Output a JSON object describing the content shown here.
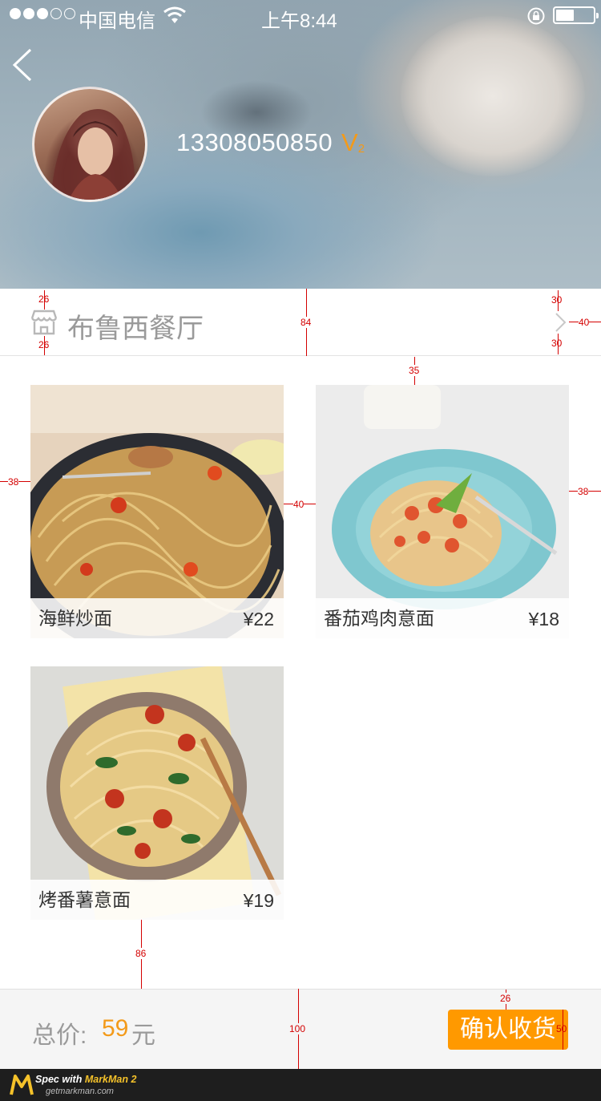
{
  "status_bar": {
    "carrier": "中国电信",
    "time": "上午8:44",
    "signal_dots_filled": 3,
    "signal_dots_total": 5
  },
  "profile": {
    "phone": "13308050850",
    "vip_letter": "V",
    "vip_level": "2",
    "vip_color": "#f39a1a"
  },
  "shop": {
    "icon": "store-icon",
    "name": "布鲁西餐厅"
  },
  "products": [
    {
      "name": "海鲜炒面",
      "price": "¥22"
    },
    {
      "name": "番茄鸡肉意面",
      "price": "¥18"
    },
    {
      "name": "烤番薯意面",
      "price": "¥19"
    }
  ],
  "footer": {
    "total_label": "总价:",
    "total_value": "59",
    "total_unit": "元",
    "confirm_label": "确认收货",
    "accent_color": "#ff9900"
  },
  "markman": {
    "title_prefix": "Spec with ",
    "title_brand": "MarkMan 2",
    "site": "getmarkman.com"
  },
  "spec_annotations": {
    "shop_icon_top": "26",
    "shop_icon_bottom": "26",
    "shop_row_height": "84",
    "arrow_top": "30",
    "arrow_right": "40",
    "arrow_bottom": "30",
    "grid_top": "35",
    "grid_left": "38",
    "grid_gap": "40",
    "grid_right": "38",
    "grid_bottom": "86",
    "bottom_bar_height": "100",
    "button_right": "26",
    "button_height": "50"
  }
}
